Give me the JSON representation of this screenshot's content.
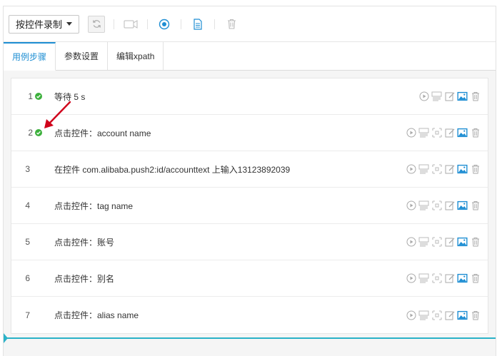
{
  "toolbar": {
    "record_label": "按控件录制",
    "icons": [
      "refresh-icon",
      "video-icon",
      "stop-record-icon",
      "document-icon",
      "trash-icon"
    ]
  },
  "tabs": [
    {
      "label": "用例步骤",
      "active": true
    },
    {
      "label": "参数设置",
      "active": false
    },
    {
      "label": "编辑xpath",
      "active": false
    }
  ],
  "steps": [
    {
      "num": "1",
      "text": "等待 5 s",
      "passed": true
    },
    {
      "num": "2",
      "text": "点击控件：account name",
      "passed": true
    },
    {
      "num": "3",
      "text": "在控件 com.alibaba.push2:id/accounttext 上输入13123892039",
      "passed": false
    },
    {
      "num": "4",
      "text": "点击控件：tag name",
      "passed": false
    },
    {
      "num": "5",
      "text": "点击控件：账号",
      "passed": false
    },
    {
      "num": "6",
      "text": "点击控件：别名",
      "passed": false
    },
    {
      "num": "7",
      "text": "点击控件：alias name",
      "passed": false
    }
  ],
  "colors": {
    "accent": "#1e8ed3",
    "success": "#3db03d",
    "highlight": "#2ab2c8",
    "annotation": "#d0021b"
  }
}
